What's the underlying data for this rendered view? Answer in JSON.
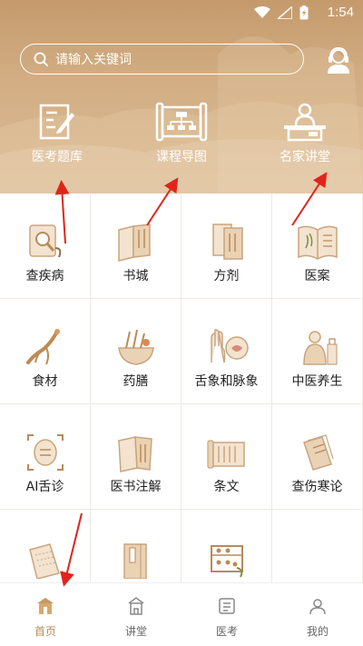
{
  "status_bar": {
    "time": "1:54"
  },
  "search": {
    "placeholder": "请输入关键词"
  },
  "features": [
    {
      "label": "医考题库",
      "icon": "exam-bank-icon"
    },
    {
      "label": "课程导图",
      "icon": "course-map-icon"
    },
    {
      "label": "名家讲堂",
      "icon": "lecture-icon"
    }
  ],
  "grid": [
    {
      "label": "查疾病",
      "icon": "disease-search-icon"
    },
    {
      "label": "书城",
      "icon": "bookstore-icon"
    },
    {
      "label": "方剂",
      "icon": "prescription-icon"
    },
    {
      "label": "医案",
      "icon": "medical-case-icon"
    },
    {
      "label": "食材",
      "icon": "ingredient-icon"
    },
    {
      "label": "药膳",
      "icon": "medicinal-diet-icon"
    },
    {
      "label": "舌象和脉象",
      "icon": "tongue-pulse-icon"
    },
    {
      "label": "中医养生",
      "icon": "health-care-icon"
    },
    {
      "label": "AI舌诊",
      "icon": "ai-tongue-icon"
    },
    {
      "label": "医书注解",
      "icon": "book-annotation-icon"
    },
    {
      "label": "条文",
      "icon": "article-icon"
    },
    {
      "label": "查伤寒论",
      "icon": "shanghan-icon"
    },
    {
      "label": "",
      "icon": "notebook-icon"
    },
    {
      "label": "",
      "icon": "classic-book-icon"
    },
    {
      "label": "",
      "icon": "abacus-icon"
    },
    {
      "label": "",
      "icon": ""
    }
  ],
  "bottom_nav": [
    {
      "label": "首页",
      "icon": "home-icon",
      "active": true
    },
    {
      "label": "讲堂",
      "icon": "lecture-hall-icon",
      "active": false
    },
    {
      "label": "医考",
      "icon": "exam-icon",
      "active": false
    },
    {
      "label": "我的",
      "icon": "profile-icon",
      "active": false
    }
  ],
  "colors": {
    "header": "#c49a6c",
    "accent": "#b9895a",
    "arrow": "#e0241b"
  }
}
